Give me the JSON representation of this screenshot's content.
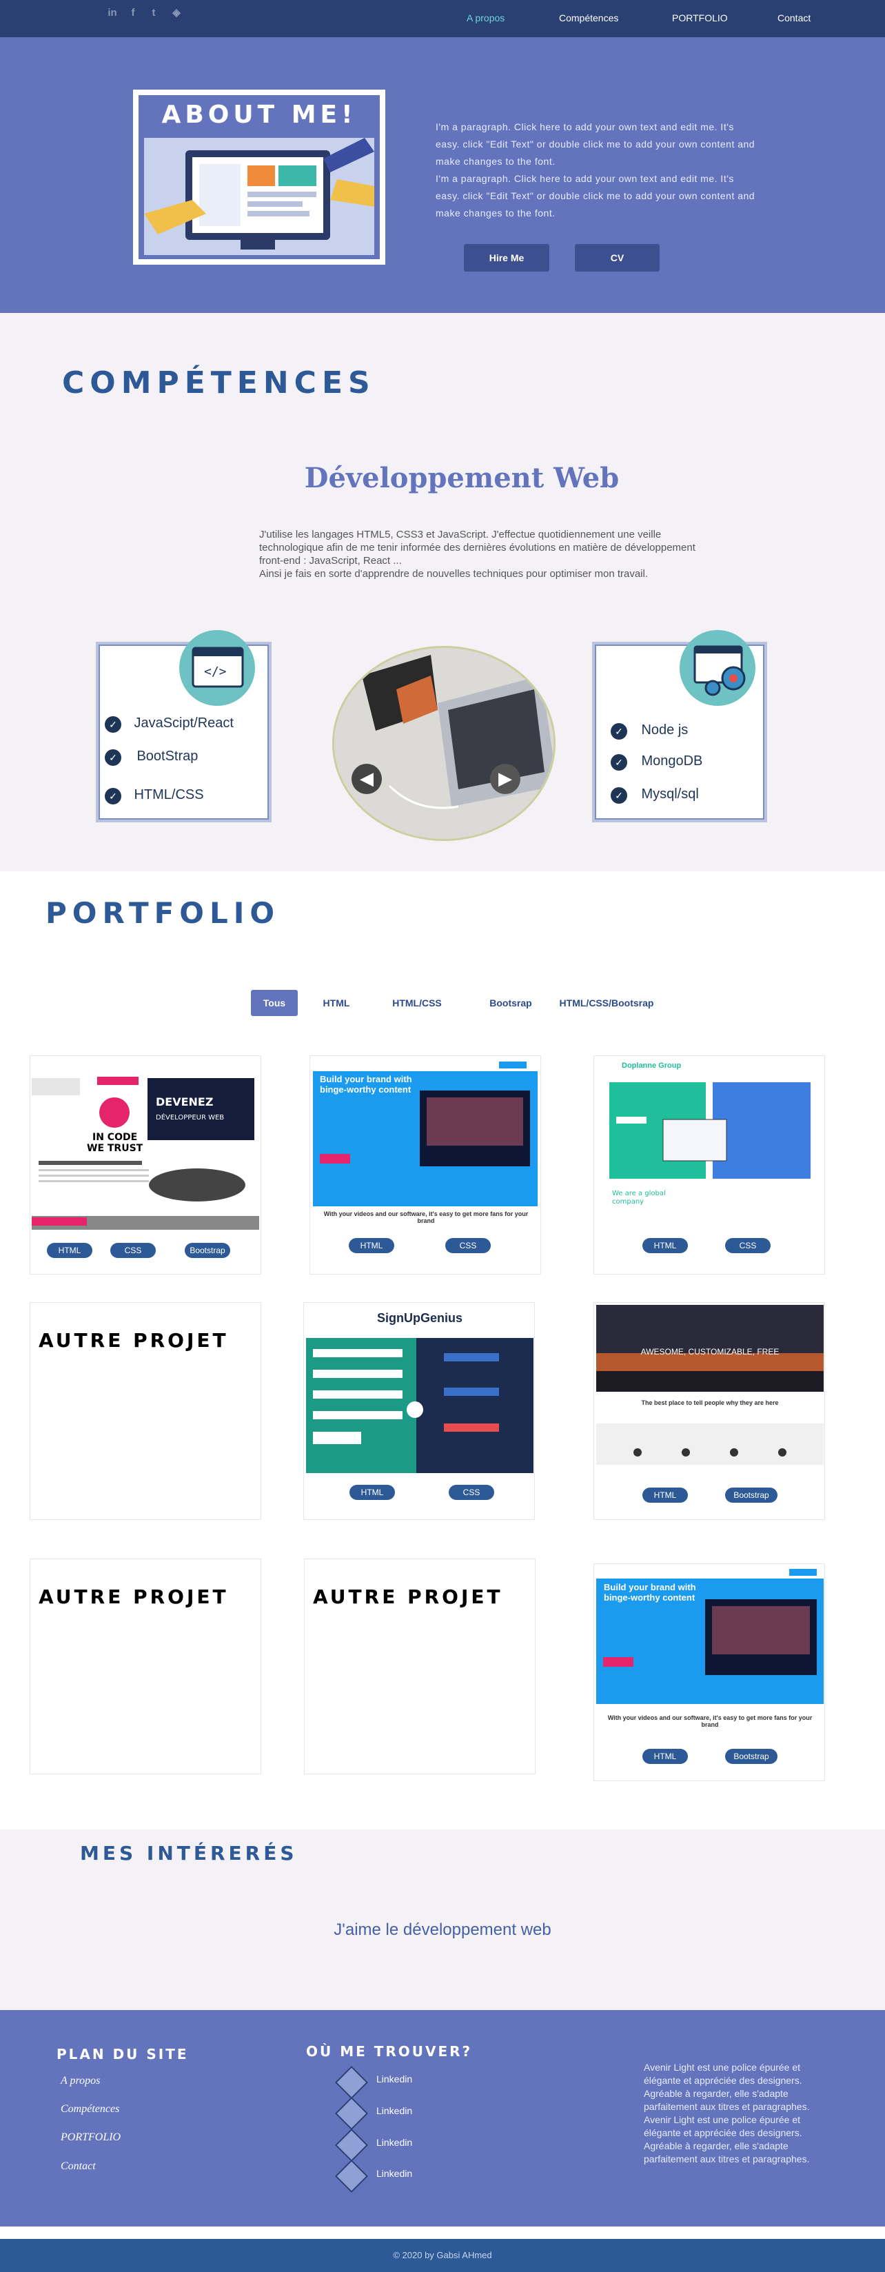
{
  "topbar": {
    "social": [
      "in",
      "f",
      "t",
      "◈"
    ],
    "nav": [
      "A propos",
      "Compétences",
      "PORTFOLIO",
      "Contact"
    ]
  },
  "hero": {
    "title": "ABOUT ME!",
    "paragraphs": [
      "I'm a paragraph. Click here to add your own text and edit me. It's easy. click \"Edit Text\" or double click me to add your own content and make changes to the font.",
      "I'm a paragraph. Click here to add your own text and edit me. It's easy. click \"Edit Text\" or double click me to add your own content and make changes to the font."
    ],
    "hire": "Hire Me",
    "cv": "CV"
  },
  "competences": {
    "title": "COMPÉTENCES",
    "subtitle": "Développement Web",
    "text1": "J'utilise les langages HTML5, CSS3  et JavaScript. J'effectue quotidiennement une veille technologique afin de me tenir informée des dernières évolutions en matière de développement front-end : JavaScript, React ...",
    "text2": "Ainsi je fais en sorte d'apprendre de nouvelles techniques pour optimiser mon travail.",
    "left_skills": [
      "JavaScipt/React",
      "BootStrap",
      "HTML/CSS"
    ],
    "right_skills": [
      "Node js",
      "MongoDB",
      "Mysql/sql"
    ]
  },
  "portfolio": {
    "title": "PORTFOLIO",
    "filters": [
      "Tous",
      "HTML",
      "HTML/CSS",
      "Bootsrap",
      "HTML/CSS/Bootsrap"
    ],
    "autre": "AUTRE PROJET",
    "cards": [
      {
        "heading": "",
        "tags": [
          "HTML",
          "CSS",
          "Bootstrap"
        ]
      },
      {
        "heading": "Build your brand with binge-worthy content",
        "caption": "With your videos and our software, it's easy to get more fans for your brand",
        "tags": [
          "HTML",
          "CSS"
        ]
      },
      {
        "heading": "Doplanne Group",
        "tags": [
          "HTML",
          "CSS"
        ]
      },
      {
        "heading": "",
        "tags": []
      },
      {
        "heading": "SignUpGenius",
        "tags": [
          "HTML",
          "CSS"
        ]
      },
      {
        "heading": "AWESOME, CUSTOMIZABLE, FREE",
        "caption": "The best place to tell people why they are here",
        "tags": [
          "HTML",
          "Bootstrap"
        ]
      },
      {
        "heading": "",
        "tags": []
      },
      {
        "heading": "",
        "tags": []
      },
      {
        "heading": "Build your brand with binge-worthy content",
        "caption": "With your videos and our software, it's easy to get more fans for your brand",
        "tags": [
          "HTML",
          "Bootstrap"
        ]
      }
    ]
  },
  "interests": {
    "title": "MES INTÉRERÉS",
    "text": "J'aime le développement web"
  },
  "footer": {
    "plan_title": "PLAN DU SITE",
    "plan_links": [
      "A propos",
      "Compétences",
      "PORTFOLIO",
      "Contact"
    ],
    "where_title": "OÙ ME TROUVER?",
    "where_links": [
      "Linkedin",
      "Linkedin",
      "Linkedin",
      "Linkedin"
    ],
    "about_text": "Avenir Light est une police épurée et élégante et appréciée des designers. Agréable à regarder, elle s'adapte parfaitement aux titres et paragraphes. Avenir Light est une police épurée et élégante et appréciée des designers. Agréable à regarder, elle s'adapte parfaitement aux titres et paragraphes.",
    "copyright": "© 2020 by Gabsi AHmed"
  },
  "colors": {
    "hero": "#6374bd",
    "navy": "#2a3f72",
    "accent": "#2d5a97",
    "teal": "#6fc2c4"
  }
}
